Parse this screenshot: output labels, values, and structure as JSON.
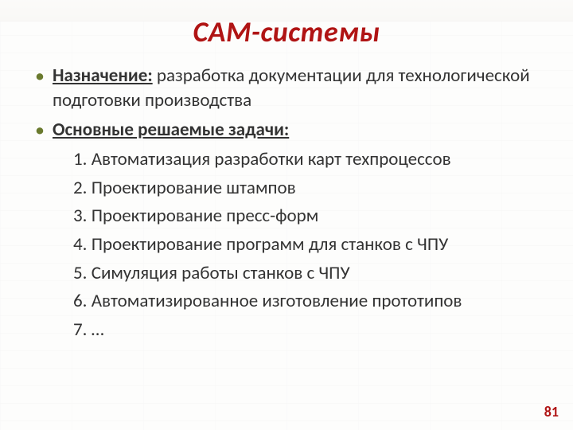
{
  "title": "CAM-системы",
  "bullets": [
    {
      "label": "Назначение:",
      "text": " разработка документации для технологической подготовки производства"
    },
    {
      "label": "Основные решаемые задачи:",
      "text": ""
    }
  ],
  "tasks": [
    "Автоматизация разработки карт техпроцессов",
    "Проектирование штампов",
    "Проектирование пресс-форм",
    "Проектирование программ для станков с ЧПУ",
    "Симуляция работы станков с ЧПУ",
    "Автоматизированное изготовление прототипов",
    "…"
  ],
  "page_number": "81",
  "colors": {
    "accent": "#b01414",
    "bullet": "#6a7a2e"
  }
}
